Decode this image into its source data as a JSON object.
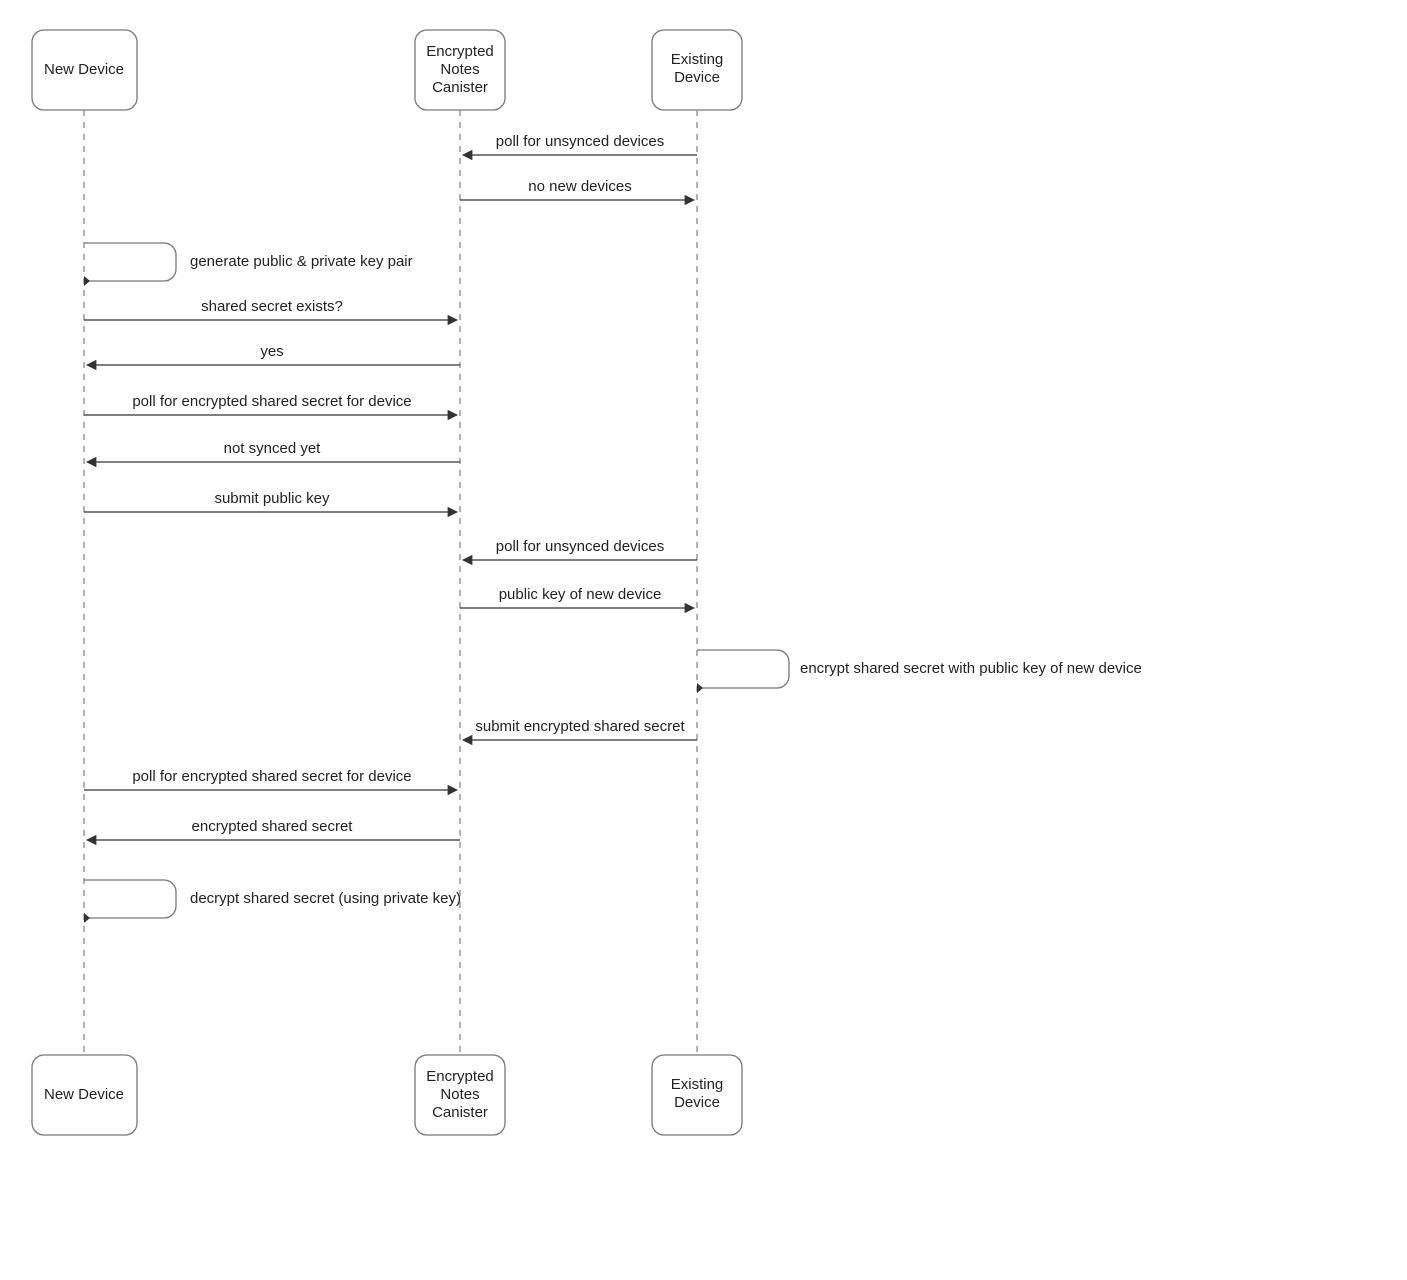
{
  "actors": {
    "newDevice": "New Device",
    "canister": "Encrypted\nNotes\nCanister",
    "existingDevice": "Existing\nDevice"
  },
  "messages": {
    "m1": "poll for unsynced devices",
    "m2": "no new devices",
    "m3": "generate public & private key pair",
    "m4": "shared secret exists?",
    "m5": "yes",
    "m6": "poll for encrypted shared secret for device",
    "m7": "not synced yet",
    "m8": "submit public key",
    "m9": "poll for unsynced devices",
    "m10": "public key of new device",
    "m11": "encrypt shared secret with public key of new device",
    "m12": "submit encrypted shared secret",
    "m13": "poll for encrypted shared secret for device",
    "m14": "encrypted shared secret",
    "m15": "decrypt shared secret (using private key)"
  }
}
